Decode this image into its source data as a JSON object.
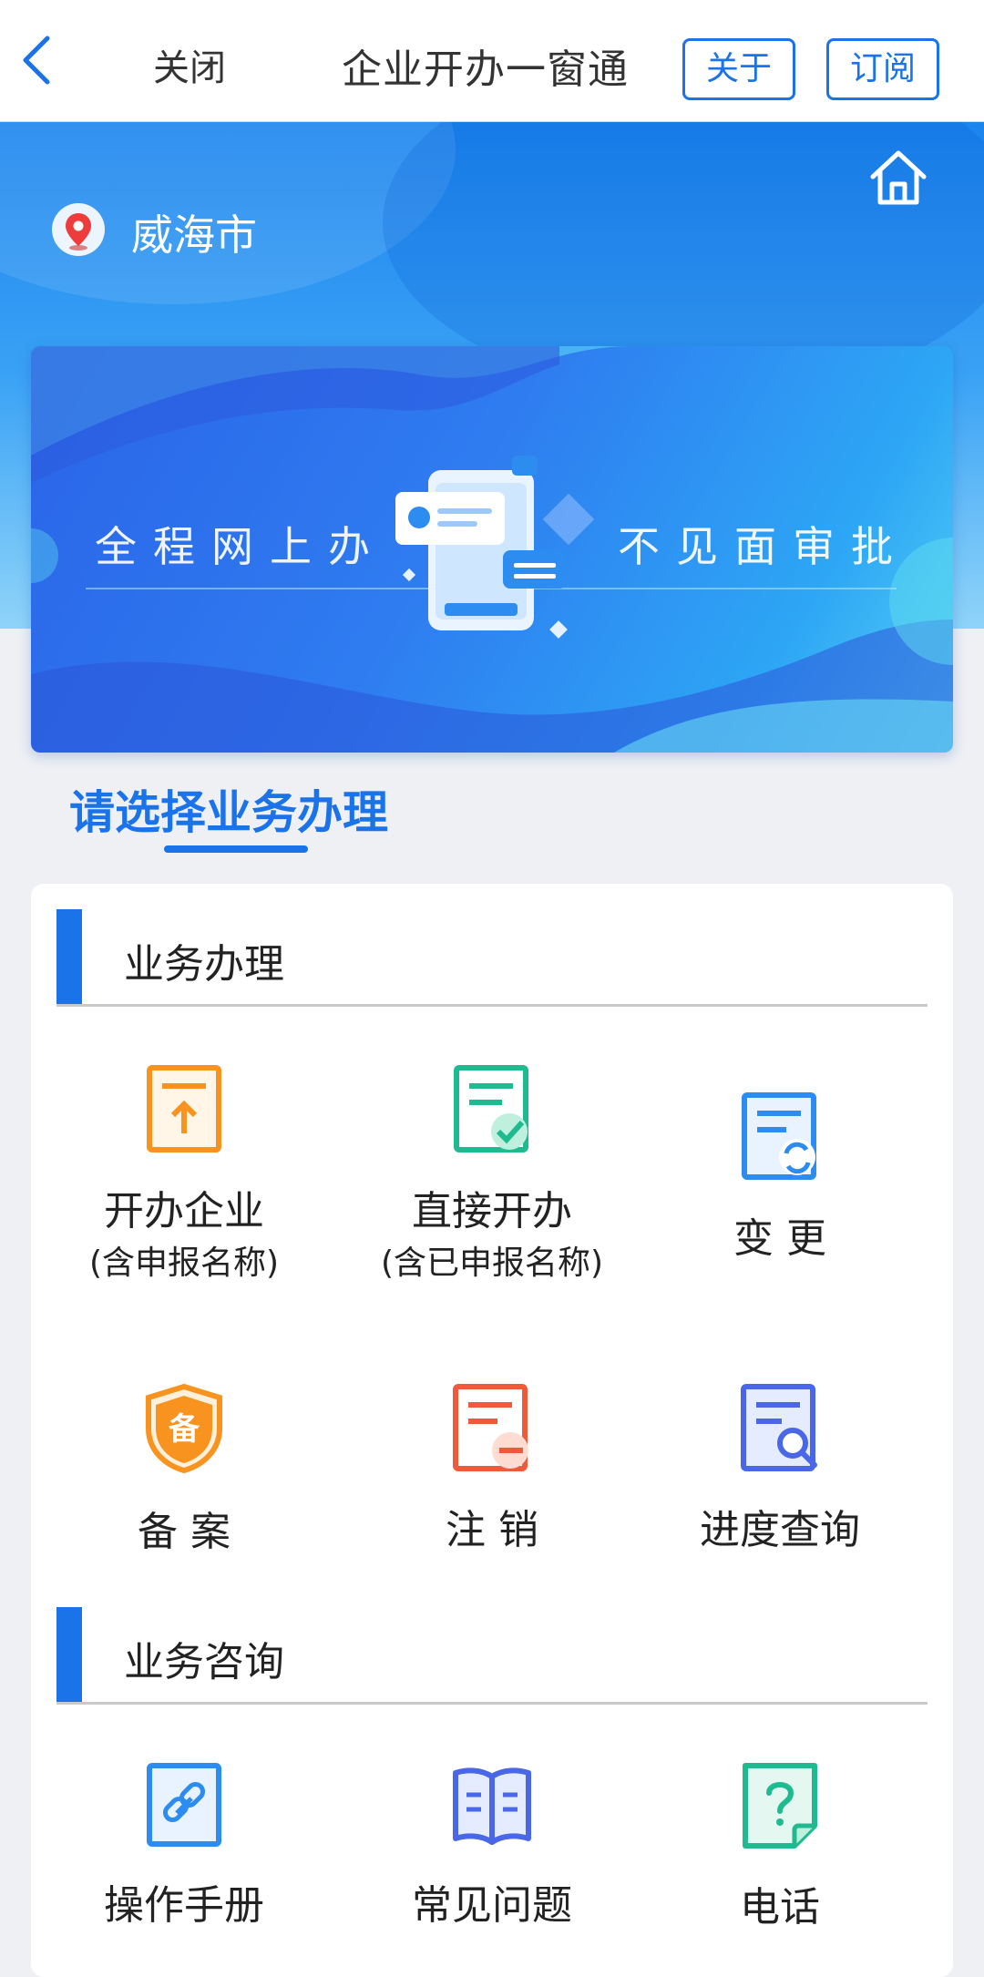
{
  "nav": {
    "close_label": "关闭",
    "title": "企业开办一窗通",
    "about_label": "关于",
    "subscribe_label": "订阅"
  },
  "header": {
    "city": "威海市"
  },
  "banner": {
    "left_text": "全程网上办",
    "right_text": "不见面审批"
  },
  "section_title": "请选择业务办理",
  "business": {
    "heading": "业务办理",
    "items": [
      {
        "title": "开办企业",
        "subtitle": "(含申报名称)",
        "icon": "upload-doc-icon"
      },
      {
        "title": "直接开办",
        "subtitle": "(含已申报名称)",
        "icon": "checked-doc-icon"
      },
      {
        "title": "变 更",
        "subtitle": "",
        "icon": "refresh-doc-icon"
      },
      {
        "title": "备 案",
        "subtitle": "",
        "icon": "record-shield-icon"
      },
      {
        "title": "注 销",
        "subtitle": "",
        "icon": "cancel-doc-icon"
      },
      {
        "title": "进度查询",
        "subtitle": "",
        "icon": "search-doc-icon"
      }
    ]
  },
  "consult": {
    "heading": "业务咨询",
    "items": [
      {
        "title": "操作手册",
        "icon": "link-icon"
      },
      {
        "title": "常见问题",
        "icon": "book-icon"
      },
      {
        "title": "电话",
        "icon": "question-doc-icon"
      }
    ]
  },
  "colors": {
    "primary": "#1a73e8",
    "orange": "#f7931e",
    "green": "#1fba8f",
    "blue": "#2d8cf0",
    "red": "#f05a3a",
    "indigo": "#4a67e8"
  }
}
